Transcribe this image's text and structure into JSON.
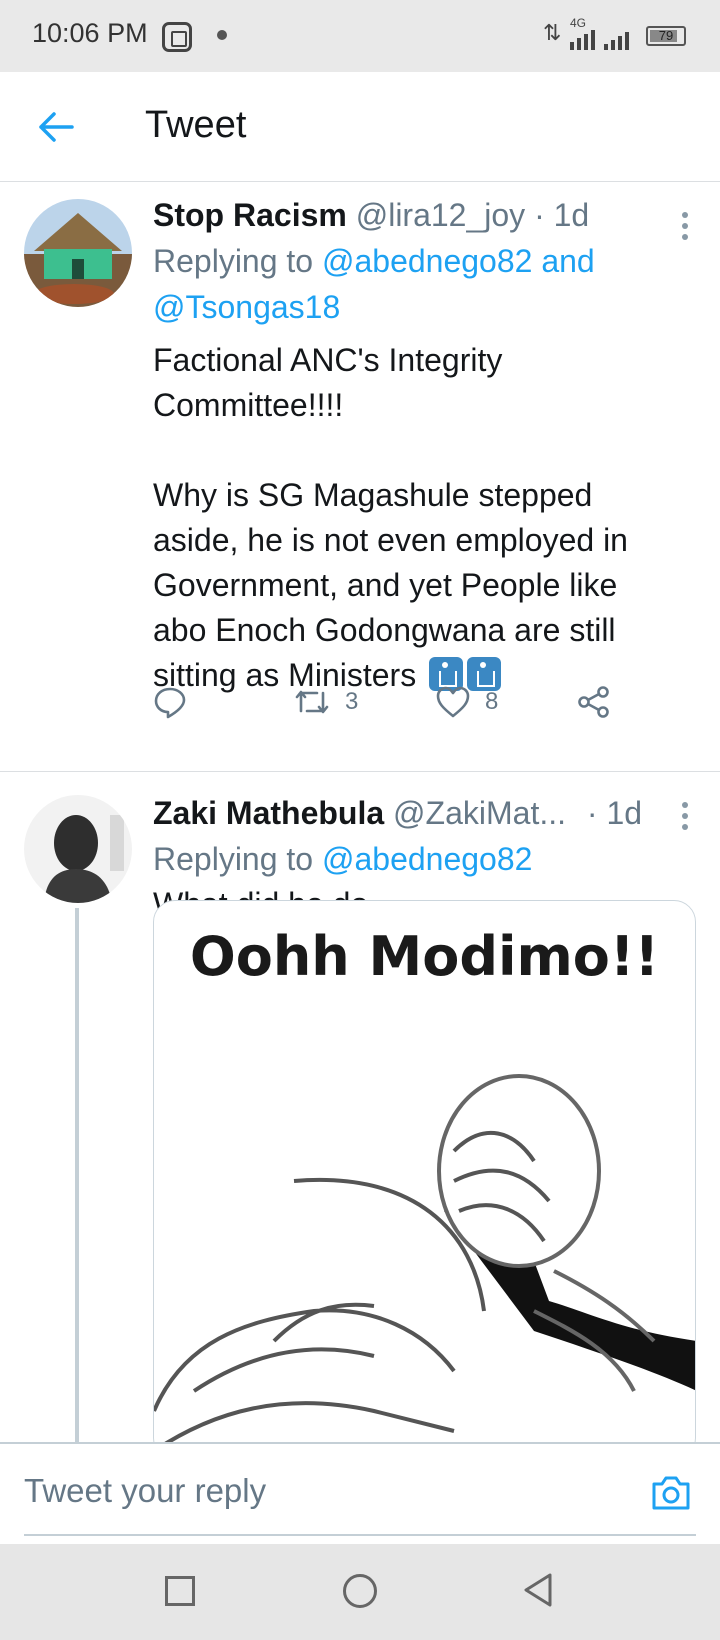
{
  "status_bar": {
    "time": "10:06 PM",
    "network": "4G",
    "battery": "79"
  },
  "header": {
    "title": "Tweet"
  },
  "tweets": [
    {
      "name": "Stop Racism",
      "handle": "@lira12_joy",
      "separator": "·",
      "time": "1d",
      "replying_prefix": "Replying to",
      "mentions": [
        "@abednego82",
        "@Tsongas18"
      ],
      "mention_joiner": "and",
      "text": "Factional ANC's Integrity Committee!!!!\n\nWhy is SG Magashule stepped aside,  he is not even employed in Government, and yet People like abo Enoch Godongwana are still sitting as Ministers",
      "emoji": [
        "put-litter-in-its-place",
        "put-litter-in-its-place"
      ],
      "retweets": "3",
      "likes": "8"
    },
    {
      "name": "Zaki Mathebula",
      "handle": "@ZakiMat...",
      "separator": "·",
      "time": "1d",
      "replying_prefix": "Replying to",
      "mentions": [
        "@abednego82"
      ],
      "text": "What did he do",
      "media_caption": "Oohh Modimo!!"
    }
  ],
  "reply_bar": {
    "placeholder": "Tweet your reply"
  },
  "colors": {
    "accent": "#1da1f2",
    "secondary_text": "#657786"
  }
}
